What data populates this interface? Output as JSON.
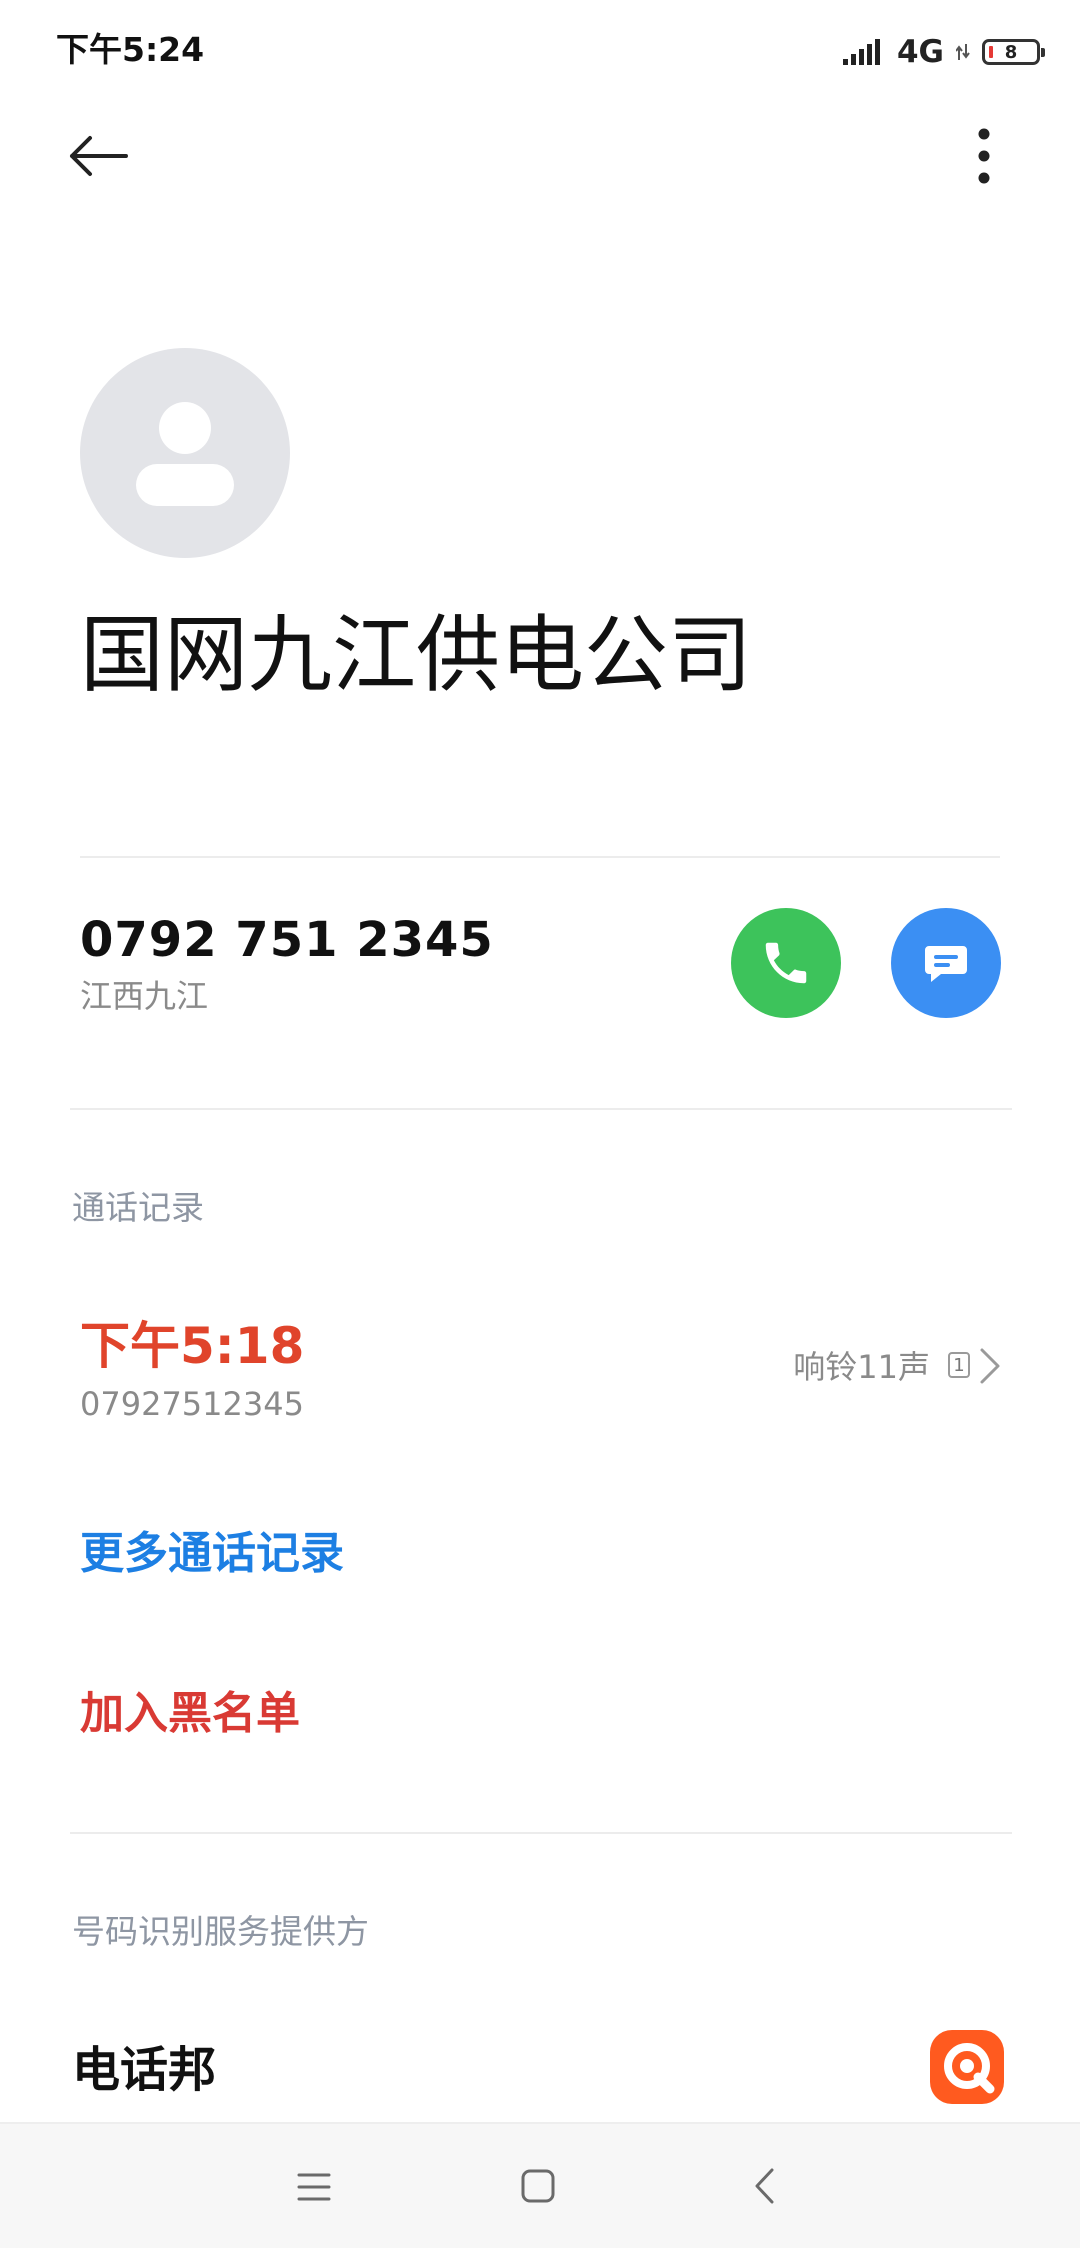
{
  "status_bar": {
    "time": "下午5:24",
    "network": "4G",
    "battery": "8"
  },
  "contact": {
    "name": "国网九江供电公司",
    "phone": "0792 751 2345",
    "location": "江西九江"
  },
  "call_log": {
    "section_title": "通话记录",
    "entries": [
      {
        "time": "下午5:18",
        "number": "07927512345",
        "detail": "响铃11声",
        "sim": "1"
      }
    ],
    "more_label": "更多通话记录"
  },
  "actions": {
    "block_label": "加入黑名单"
  },
  "provider": {
    "section_title": "号码识别服务提供方",
    "name": "电话邦"
  },
  "colors": {
    "call_button": "#3dc35b",
    "message_button": "#3b8ff3",
    "missed_call_time": "#e0442b",
    "link_blue": "#1d7fe3",
    "danger_red": "#d93a34",
    "provider_logo": "#ff5a1f"
  },
  "icons": {
    "back": "arrow-left-icon",
    "more": "more-vertical-icon",
    "avatar": "person-icon",
    "call": "phone-icon",
    "message": "message-icon",
    "detail": "chevron-right-icon",
    "provider_logo": "dianhuabang-logo-icon",
    "nav_menu": "menu-icon",
    "nav_home": "home-square-icon",
    "nav_back": "chevron-left-icon"
  }
}
